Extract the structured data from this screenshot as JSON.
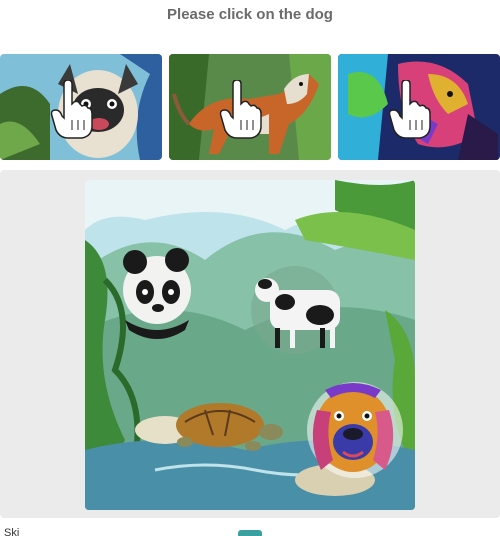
{
  "instruction": {
    "text": "Please click on the dog"
  },
  "examples": [
    {
      "subject": "pug-dog",
      "palette": [
        "#3d6b2e",
        "#e8e0d0",
        "#2a2a2a",
        "#7fbfd8"
      ]
    },
    {
      "subject": "hound-dog",
      "palette": [
        "#4a7a3a",
        "#c8662a",
        "#e6dfcf",
        "#8a5a3a"
      ]
    },
    {
      "subject": "colorful-dog",
      "palette": [
        "#1c2a6a",
        "#d8407a",
        "#30b0d8",
        "#e0b030"
      ]
    }
  ],
  "challenge": {
    "subjects": [
      "panda",
      "cow",
      "turtle",
      "dog"
    ],
    "palette": {
      "sky": "#bfe3ea",
      "hill": "#86c1a8",
      "jungle": "#3d8a3a",
      "water": "#4a8fa8"
    }
  },
  "footer": {
    "left_text": "Ski"
  }
}
